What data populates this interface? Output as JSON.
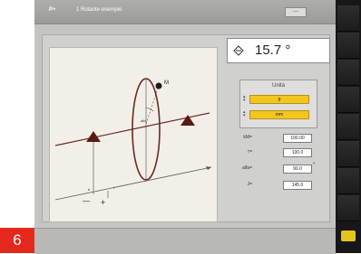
{
  "figure_label": "6",
  "titlebar": {
    "program": "P+",
    "title": "1  Rotante esempio",
    "status": "----"
  },
  "angle_display": {
    "icon": "angle-icon",
    "value": "15.7 °"
  },
  "units": {
    "label": "Unità",
    "selector1": "g",
    "selector2": "mm"
  },
  "fields": [
    {
      "label": "kM=",
      "value": "100.00"
    },
    {
      "label": "r=",
      "value": "100.0"
    },
    {
      "label": "alfa=",
      "value": "90.0",
      "unit": "°"
    },
    {
      "label": "J=",
      "value": "145.0"
    }
  ],
  "diagram": {
    "point_label": "M",
    "angle_label": "alfa",
    "tick_b": "b",
    "tick_f": "f",
    "minus": "—",
    "plus": "+"
  },
  "colors": {
    "screen_bg": "#c4c4c2",
    "accent_yellow": "#f2c61f",
    "figure_red": "#e4291c",
    "diagram_maroon": "#6a2a22"
  }
}
